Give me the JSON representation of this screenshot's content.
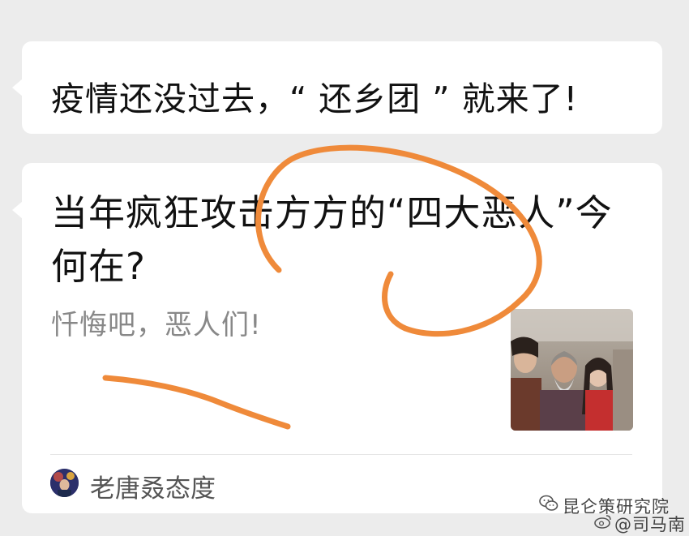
{
  "messages": [
    {
      "title": "疫情还没过去，“ 还乡团 ” 就来了!"
    },
    {
      "title_line1": "当年疯狂攻击方方的“四大恶人”今",
      "title_line2": "何在?",
      "summary": "忏悔吧，恶人们!",
      "thumbnail_icon": "drama-still-image",
      "account_name": "老唐叒态度",
      "account_avatar_icon": "account-avatar"
    }
  ],
  "watermark": {
    "line1": "昆仑策研究院",
    "line2": "@司马南",
    "icons": [
      "wechat-icon",
      "weibo-icon"
    ]
  },
  "annotation_color": "#ef8a3a",
  "background_color": "#ececec"
}
